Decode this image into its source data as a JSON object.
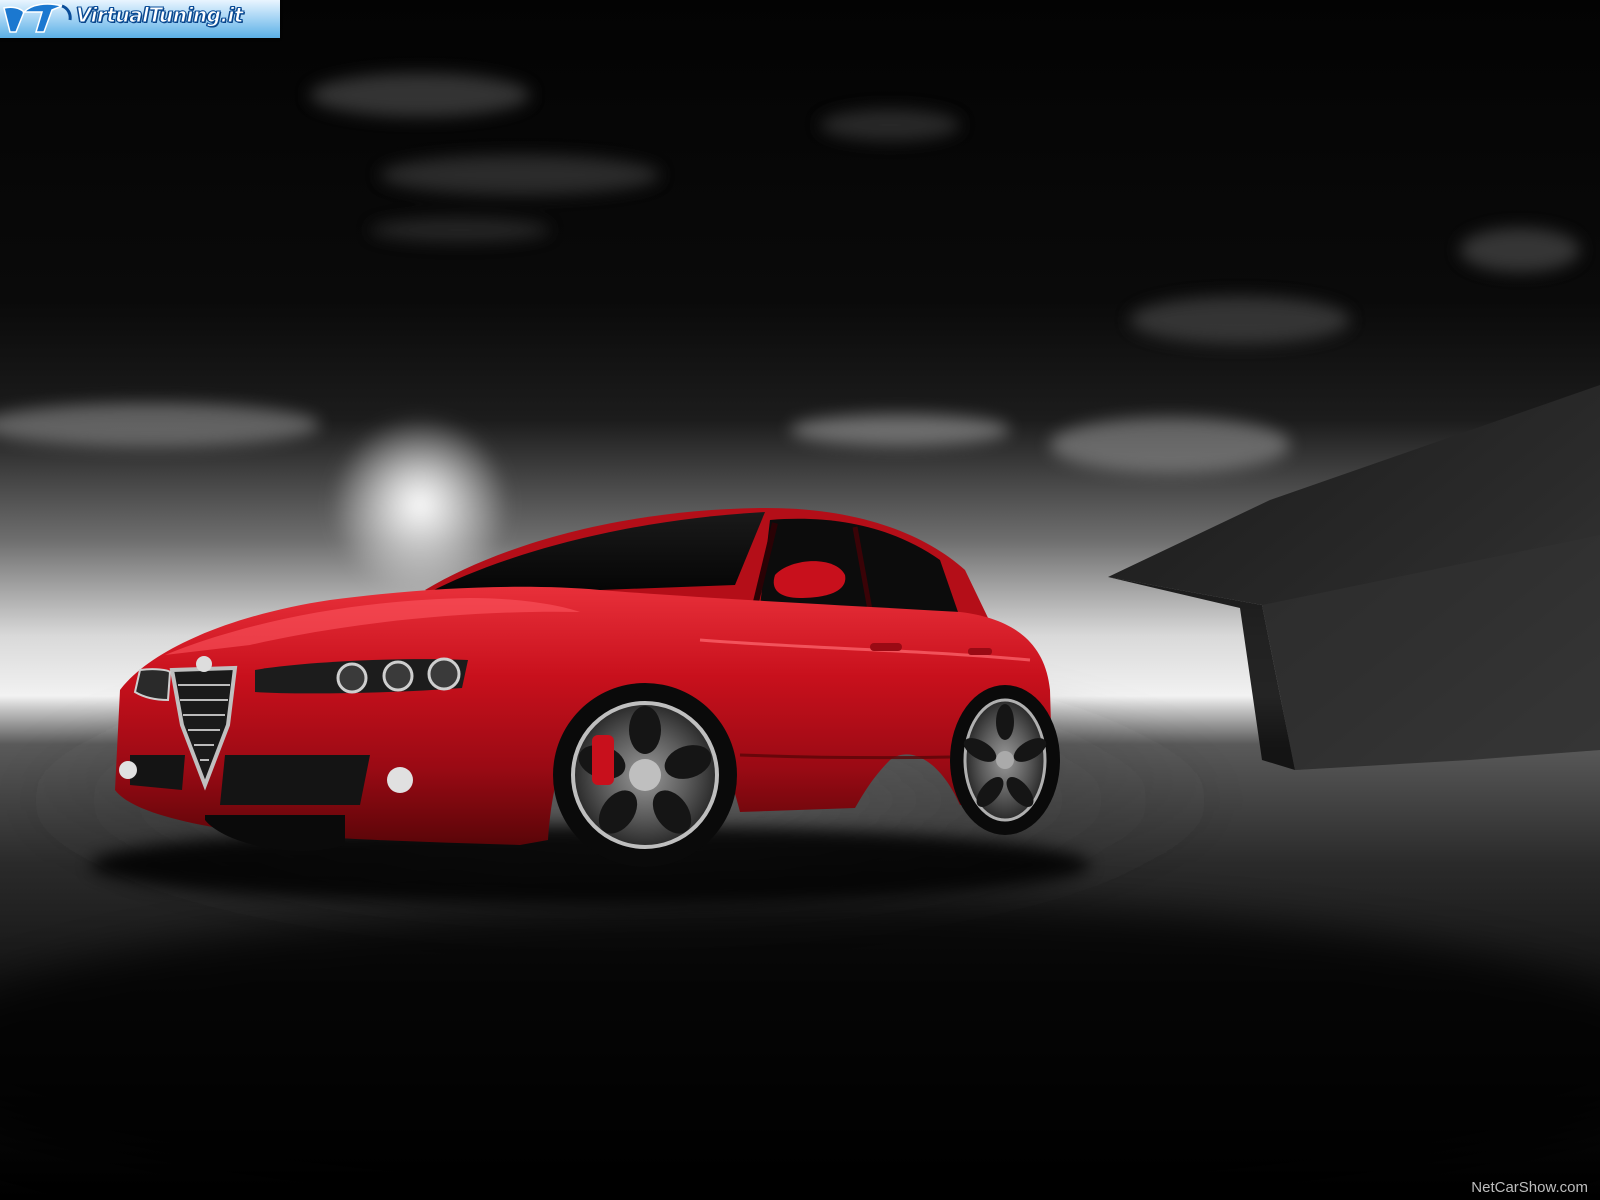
{
  "watermark": {
    "site_name": "VirtualTuning.it",
    "logo_icon": "vt-logo-icon",
    "colors": {
      "banner_light": "#e9f5ff",
      "banner_dark": "#5bb0e6",
      "text_outline": "#0a4d99"
    }
  },
  "credit": {
    "text": "NetCarShow.com"
  },
  "scene": {
    "colors": {
      "car_body": "#c8101c",
      "sky_dark": "#050505",
      "horizon_light": "#e6e6e6",
      "ground": "#2a2a2a"
    }
  }
}
